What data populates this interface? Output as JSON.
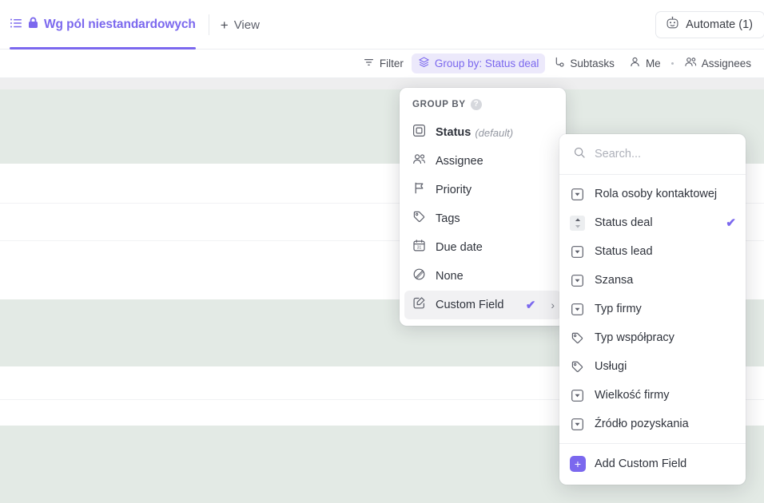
{
  "header": {
    "view_tab": {
      "label": "Wg pól niestandardowych",
      "list_icon": "list-icon",
      "lock_icon": "lock-icon"
    },
    "add_view": {
      "label": "View",
      "plus": "+"
    },
    "automate": {
      "label": "Automate (1)",
      "icon": "robot-icon"
    }
  },
  "toolbar": {
    "filter": {
      "label": "Filter",
      "icon": "filter-icon"
    },
    "group_by": {
      "label": "Group by: Status deal",
      "icon": "layers-icon",
      "active": true
    },
    "subtasks": {
      "label": "Subtasks",
      "icon": "subtask-icon"
    },
    "me": {
      "label": "Me",
      "icon": "person-icon"
    },
    "assignees": {
      "label": "Assignees",
      "icon": "people-icon"
    }
  },
  "group_by_menu": {
    "title": "GROUP BY",
    "help_glyph": "?",
    "items": [
      {
        "label": "Status",
        "suffix": "(default)",
        "icon": "status-square-icon",
        "bold": true,
        "selected": false,
        "check": false,
        "chevron": false
      },
      {
        "label": "Assignee",
        "suffix": "",
        "icon": "people-icon",
        "bold": false,
        "selected": false,
        "check": false,
        "chevron": false
      },
      {
        "label": "Priority",
        "suffix": "",
        "icon": "flag-icon",
        "bold": false,
        "selected": false,
        "check": false,
        "chevron": false
      },
      {
        "label": "Tags",
        "suffix": "",
        "icon": "tag-icon",
        "bold": false,
        "selected": false,
        "check": false,
        "chevron": false
      },
      {
        "label": "Due date",
        "suffix": "",
        "icon": "calendar-icon",
        "bold": false,
        "selected": false,
        "check": false,
        "chevron": false
      },
      {
        "label": "None",
        "suffix": "",
        "icon": "none-circle-icon",
        "bold": false,
        "selected": false,
        "check": false,
        "chevron": false
      },
      {
        "label": "Custom Field",
        "suffix": "",
        "icon": "edit-box-icon",
        "bold": false,
        "selected": true,
        "check": true,
        "chevron": true
      }
    ],
    "check_glyph": "✔",
    "chevron_glyph": "›"
  },
  "custom_field_menu": {
    "search_placeholder": "Search...",
    "search_value": "",
    "search_icon": "search-icon",
    "check_glyph": "✔",
    "fields": [
      {
        "label": "Rola osoby kontaktowej",
        "icon": "dropdown-icon",
        "selected": false
      },
      {
        "label": "Status deal",
        "icon": "updown-chevrons-icon",
        "selected": true
      },
      {
        "label": "Status lead",
        "icon": "dropdown-icon",
        "selected": false
      },
      {
        "label": "Szansa",
        "icon": "dropdown-icon",
        "selected": false
      },
      {
        "label": "Typ firmy",
        "icon": "dropdown-icon",
        "selected": false
      },
      {
        "label": "Typ współpracy",
        "icon": "tag-icon",
        "selected": false
      },
      {
        "label": "Usługi",
        "icon": "tag-icon",
        "selected": false
      },
      {
        "label": "Wielkość firmy",
        "icon": "dropdown-icon",
        "selected": false
      },
      {
        "label": "Źródło pozyskania",
        "icon": "dropdown-icon",
        "selected": false
      }
    ],
    "add_field": {
      "label": "Add Custom Field",
      "plus": "+",
      "icon": "plus-square-icon"
    }
  },
  "colors": {
    "accent_purple": "#7b68ee",
    "group_band_green": "#e3eae5",
    "pill_background": "#ece9fb",
    "row_white": "#ffffff"
  }
}
